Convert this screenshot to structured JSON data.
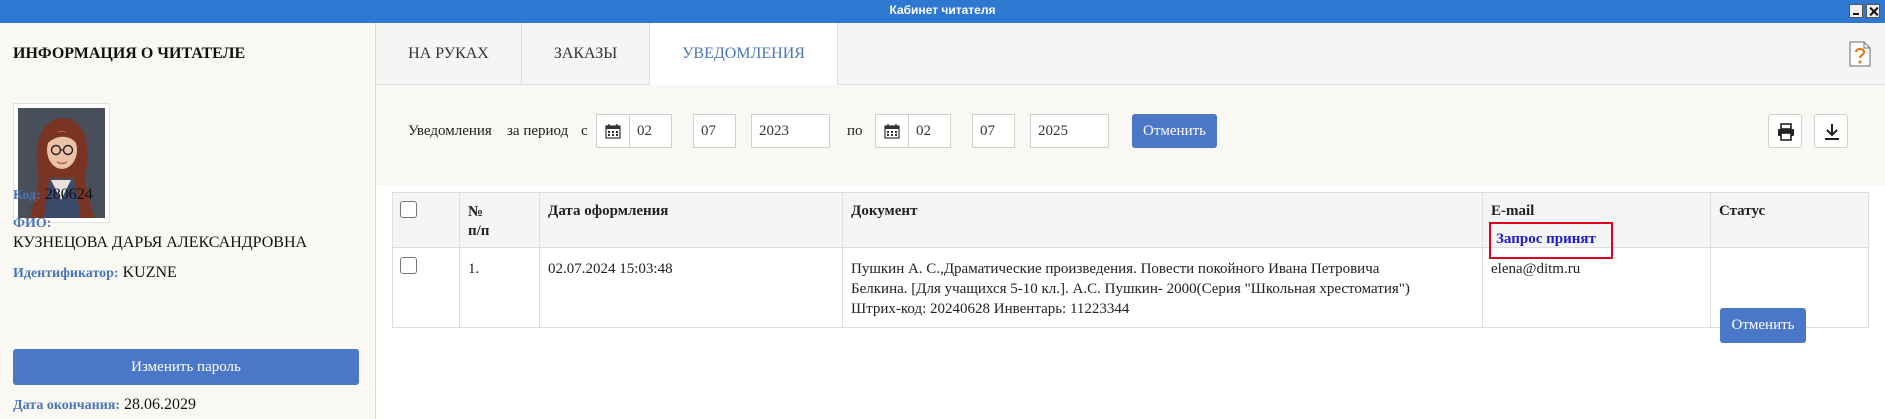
{
  "window": {
    "title": "Кабинет читателя"
  },
  "sidebar": {
    "heading": "ИНФОРМАЦИЯ О ЧИТАТЕЛЕ",
    "code_label": "Код:",
    "code_value": "280624",
    "fio_label": "ФИО:",
    "fio_value": "КУЗНЕЦОВА ДАРЬЯ АЛЕКСАНДРОВНА",
    "id_label": "Идентификатор:",
    "id_value": "KUZNE",
    "change_password": "Изменить пароль",
    "expiry_label": "Дата окончания:",
    "expiry_value": "28.06.2029"
  },
  "tabs": [
    {
      "label": "НА РУКАХ",
      "active": false
    },
    {
      "label": "ЗАКАЗЫ",
      "active": false
    },
    {
      "label": "УВЕДОМЛЕНИЯ",
      "active": true
    }
  ],
  "filter": {
    "label1": "Уведомления",
    "label2": "за период",
    "from_prefix": "с",
    "to_prefix": "по",
    "from": {
      "day": "02",
      "month": "07",
      "year": "2023"
    },
    "to": {
      "day": "02",
      "month": "07",
      "year": "2025"
    },
    "apply_label": "Отменить"
  },
  "table": {
    "headers": {
      "num": "№ п/п",
      "num_l1": "№",
      "num_l2": "п/п",
      "date": "Дата оформления",
      "doc": "Документ",
      "email": "E-mail",
      "status": "Статус"
    },
    "rows": [
      {
        "num": "1.",
        "date": "02.07.2024 15:03:48",
        "doc_line1": "Пушкин А. С.,Драматические произведения. Повести покойного Ивана Петровича",
        "doc_line2": "Белкина. [Для учащихся 5-10 кл.]. А.С. Пушкин- 2000(Серия \"Школьная хрестоматия\")",
        "doc_line3": "Штрих-код: 20240628 Инвентарь: 11223344",
        "email": "elena@ditm.ru",
        "status": "Запрос принят",
        "action": "Отменить"
      }
    ]
  },
  "colors": {
    "titlebar": "#2f78d2",
    "accent": "#4a77c7",
    "status": "#1a1ad0",
    "highlight": "#e0001b"
  }
}
